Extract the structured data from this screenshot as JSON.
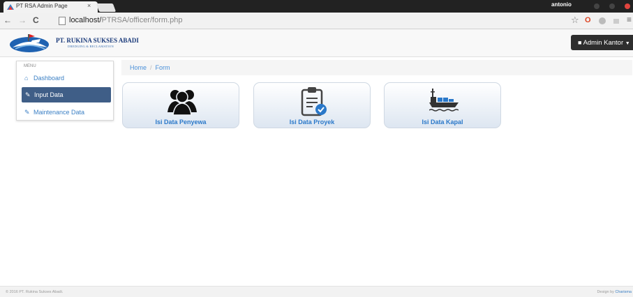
{
  "browser": {
    "tab_title": "PT RSA Admin Page",
    "tab_close": "×",
    "user": "antonio",
    "url_host": "localhost/",
    "url_path": "PTRSA/officer/form.php",
    "back": "←",
    "forward": "→",
    "reload": "C",
    "star": "☆",
    "opera": "O",
    "menu": "≡"
  },
  "header": {
    "brand": "PT. RUKINA SUKSES ABADI",
    "brand_sub": "DREDGING & RECLAMATION",
    "admin_label": "Admin Kantor"
  },
  "sidebar": {
    "menu_label": "MENU",
    "items": [
      {
        "label": "Dashboard"
      },
      {
        "label": "Input Data"
      },
      {
        "label": "Maintenance Data"
      }
    ]
  },
  "breadcrumb": {
    "home": "Home",
    "sep": "/",
    "current": "Form"
  },
  "cards": [
    {
      "label": "Isi Data Penyewa"
    },
    {
      "label": "Isi Data Proyek"
    },
    {
      "label": "Isi Data Kapal"
    }
  ],
  "footer": {
    "copyright": "© 2016 PT. Rukina Sukses Abadi.",
    "design_by": "Design by",
    "designer": "Charisma"
  },
  "colors": {
    "accent": "#3a7fc4",
    "active_menu": "#3f5e87",
    "admin_button": "#2e2e2e"
  }
}
